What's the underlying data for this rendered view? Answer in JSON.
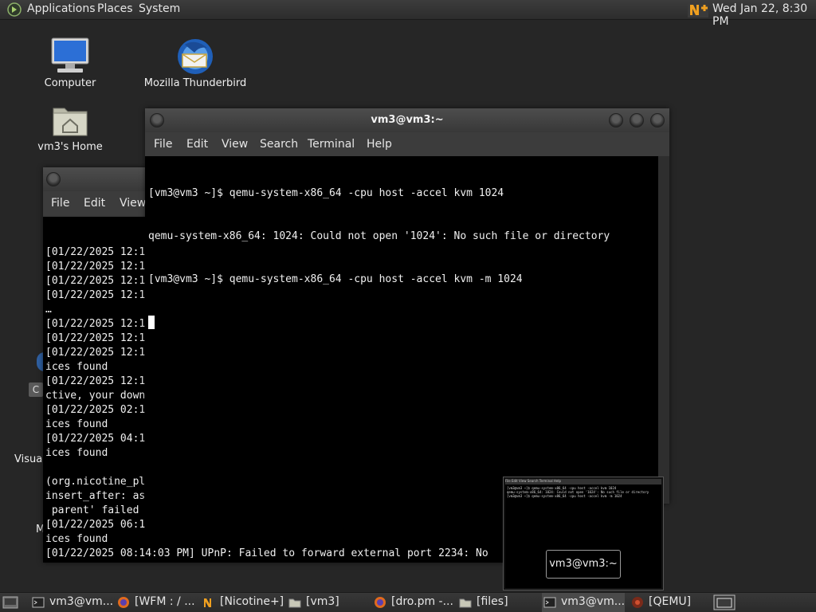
{
  "top_panel": {
    "menus": [
      "Applications",
      "Places",
      "System"
    ],
    "clock": "Wed Jan 22,  8:30 PM"
  },
  "desktop": {
    "icons": [
      {
        "label": "Computer"
      },
      {
        "label": "Mozilla Thunderbird"
      },
      {
        "label": "vm3's Home"
      },
      {
        "label": "Visual"
      },
      {
        "label": "M"
      },
      {
        "label": "C"
      }
    ]
  },
  "back_window": {
    "menus": [
      "File",
      "Edit",
      "View"
    ],
    "lines": [
      "[01/22/2025 12:1",
      "[01/22/2025 12:1",
      "[01/22/2025 12:1",
      "[01/22/2025 12:1",
      "…",
      "[01/22/2025 12:1",
      "[01/22/2025 12:1",
      "[01/22/2025 12:1",
      "ices found",
      "[01/22/2025 12:1",
      "ctive, your down",
      "[01/22/2025 02:1",
      "ices found",
      "[01/22/2025 04:1",
      "ices found",
      "",
      "(org.nicotine_pl",
      "insert_after: as",
      " parent' failed",
      "[01/22/2025 06:1",
      "ices found",
      "[01/22/2025 08:14:03 PM] UPnP: Failed to forward external port 2234: No",
      "ices found"
    ]
  },
  "front_window": {
    "title": "vm3@vm3:~",
    "menus": [
      "File",
      "Edit",
      "View",
      "Search",
      "Terminal",
      "Help"
    ],
    "lines": [
      "[vm3@vm3 ~]$ qemu-system-x86_64 -cpu host -accel kvm 1024",
      "qemu-system-x86_64: 1024: Could not open '1024': No such file or directory",
      "[vm3@vm3 ~]$ qemu-system-x86_64 -cpu host -accel kvm -m 1024"
    ]
  },
  "preview": {
    "label": "vm3@vm3:~",
    "mini_menu": "File  Edit  View  Search  Terminal  Help",
    "mini_lines": [
      "[vm3@vm3 ~]$ qemu-system-x86_64 -cpu host -accel kvm 1024",
      "qemu-system-x86_64: 1024: Could not open '1024': No such file or directory",
      "[vm3@vm3 ~]$ qemu-system-x86_64 -cpu host -accel kvm -m 1024"
    ]
  },
  "taskbar": {
    "items": [
      {
        "label": "vm3@vm...",
        "icon": "terminal-icon"
      },
      {
        "label": "[WFM : / ...",
        "icon": "firefox-icon"
      },
      {
        "label": "[Nicotine+]",
        "icon": "nicotine-icon"
      },
      {
        "label": "[vm3]",
        "icon": "folder-icon"
      },
      {
        "label": "[dro.pm -...",
        "icon": "firefox-icon"
      },
      {
        "label": "[files]",
        "icon": "folder-icon"
      },
      {
        "label": "vm3@vm...",
        "icon": "terminal-icon"
      },
      {
        "label": "[QEMU]",
        "icon": "qemu-icon"
      }
    ]
  }
}
